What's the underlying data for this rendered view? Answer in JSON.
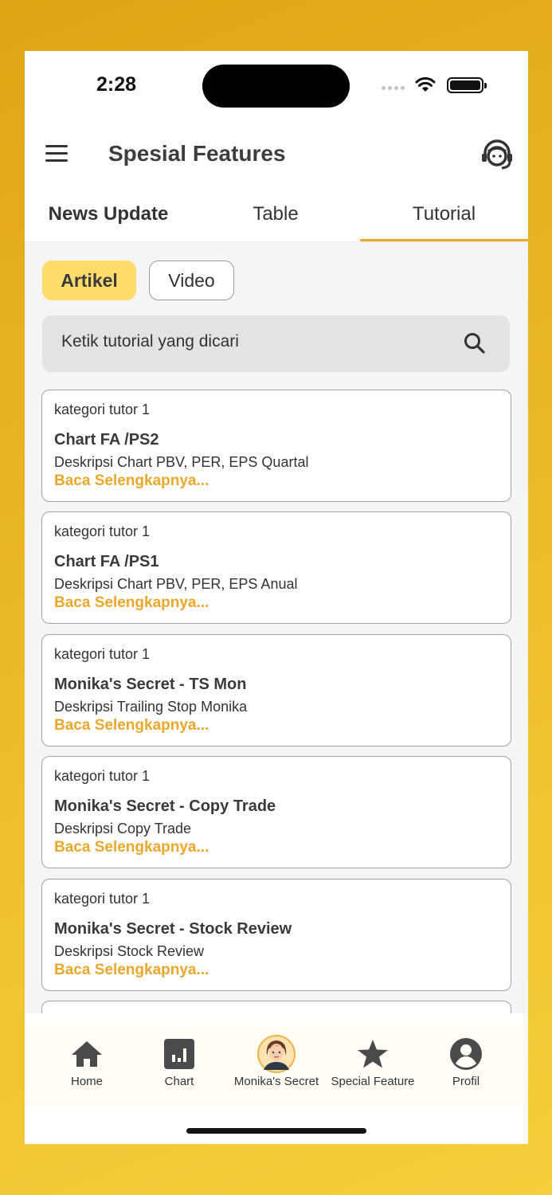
{
  "status_bar": {
    "time": "2:28"
  },
  "app_bar": {
    "title": "Spesial Features"
  },
  "tabs": [
    {
      "label": "News Update"
    },
    {
      "label": "Table"
    },
    {
      "label": "Tutorial"
    }
  ],
  "filters": [
    {
      "label": "Artikel"
    },
    {
      "label": "Video"
    }
  ],
  "search": {
    "placeholder": "Ketik tutorial yang dicari"
  },
  "cards": [
    {
      "category": "kategori tutor 1",
      "title": "Chart FA /PS2",
      "description": "Deskripsi Chart  PBV, PER, EPS Quartal",
      "link": "Baca Selengkapnya..."
    },
    {
      "category": "kategori tutor 1",
      "title": "Chart FA /PS1",
      "description": "Deskripsi Chart  PBV, PER, EPS Anual",
      "link": "Baca Selengkapnya..."
    },
    {
      "category": "kategori tutor 1",
      "title": "Monika's Secret - TS Mon",
      "description": "Deskripsi Trailing Stop Monika",
      "link": "Baca Selengkapnya..."
    },
    {
      "category": "kategori tutor 1",
      "title": "Monika's Secret - Copy Trade",
      "description": "Deskripsi Copy Trade",
      "link": "Baca Selengkapnya..."
    },
    {
      "category": "kategori tutor 1",
      "title": "Monika's Secret - Stock Review",
      "description": "Deskripsi Stock Review",
      "link": "Baca Selengkapnya..."
    }
  ],
  "bottom_nav": [
    {
      "label": "Home",
      "icon": "home-icon"
    },
    {
      "label": "Chart",
      "icon": "chart-icon"
    },
    {
      "label": "Monika's Secret",
      "icon": "avatar"
    },
    {
      "label": "Special Feature",
      "icon": "star-icon"
    },
    {
      "label": "Profil",
      "icon": "profile-icon"
    }
  ],
  "colors": {
    "accent": "#eba72b",
    "chip_active": "#ffdc6c",
    "background": "#f4f5f7"
  }
}
